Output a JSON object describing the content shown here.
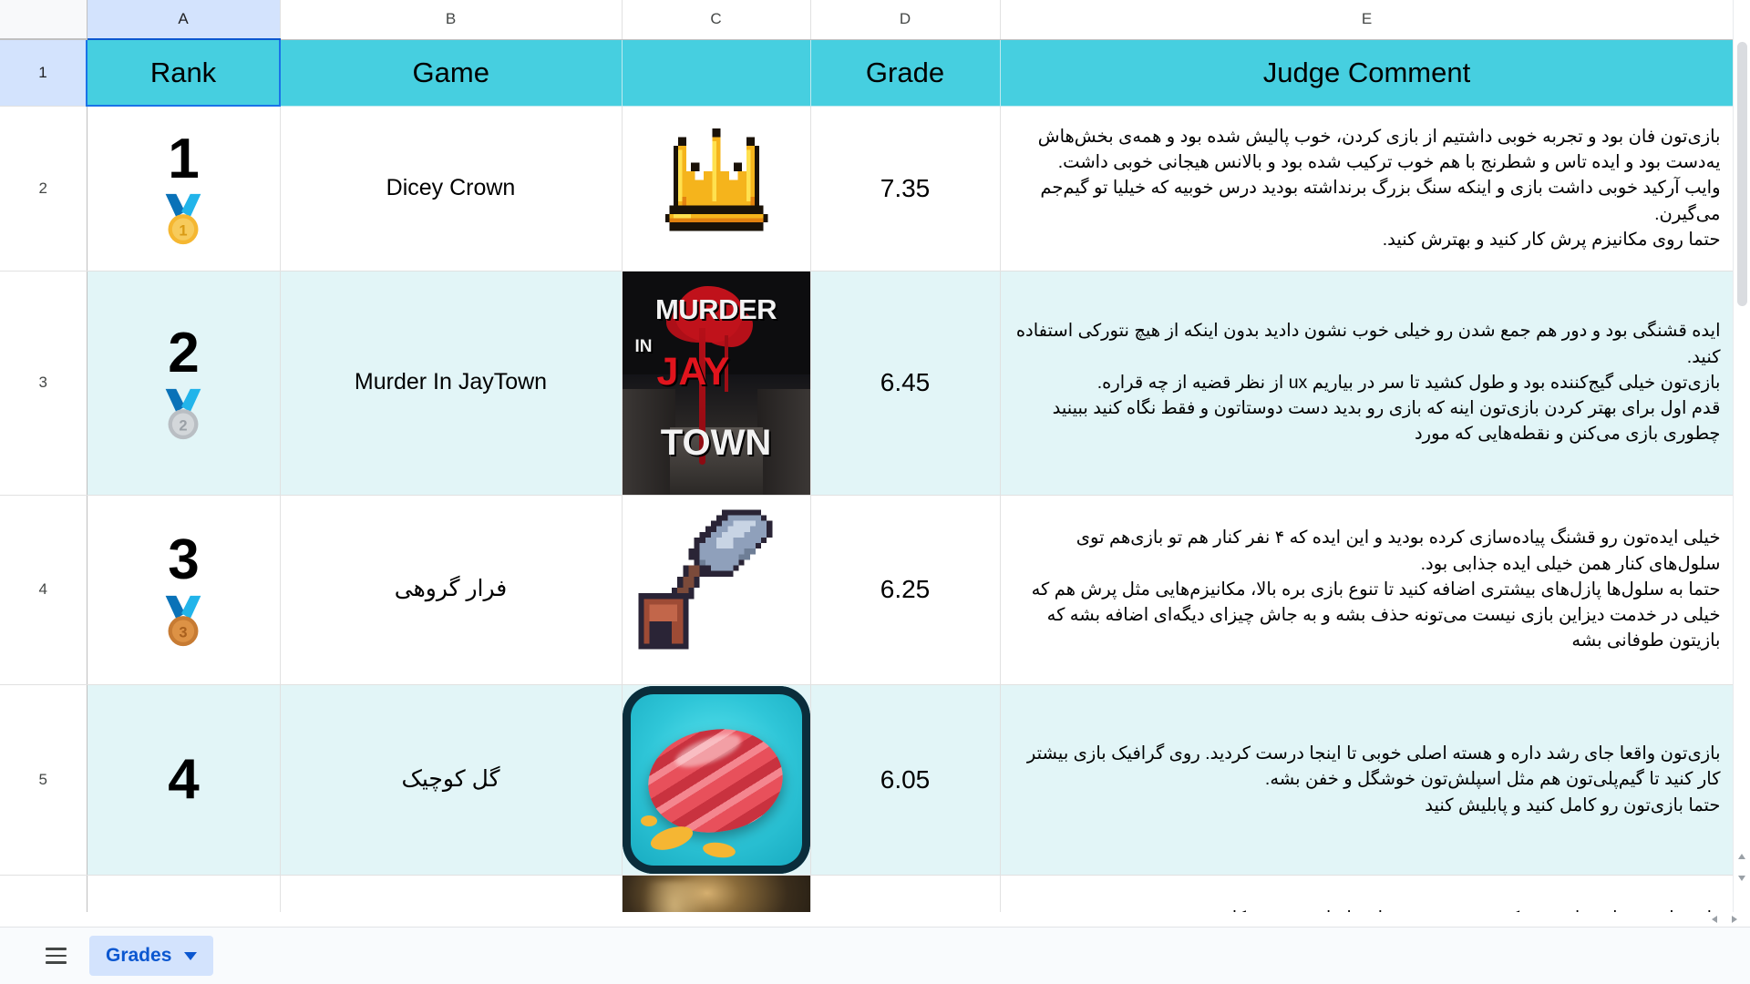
{
  "app": {
    "type": "spreadsheet"
  },
  "colors": {
    "header_band": "#46cfe0",
    "banding_alt": "#e2f5f7",
    "active_header": "#d3e3fd",
    "accent_blue": "#0b57d0",
    "selection_border": "#1a73e8"
  },
  "column_headers": [
    {
      "letter": "A",
      "active": true
    },
    {
      "letter": "B",
      "active": false
    },
    {
      "letter": "C",
      "active": false
    },
    {
      "letter": "D",
      "active": false
    },
    {
      "letter": "E",
      "active": false
    }
  ],
  "row_headers": [
    {
      "num": "1",
      "active": true
    },
    {
      "num": "2",
      "active": false
    },
    {
      "num": "3",
      "active": false
    },
    {
      "num": "4",
      "active": false
    },
    {
      "num": "5",
      "active": false
    },
    {
      "num": "",
      "active": false
    }
  ],
  "table": {
    "headers": {
      "rank": "Rank",
      "game": "Game",
      "grade": "Grade",
      "comment": "Judge Comment"
    },
    "rows": [
      {
        "rank": "1",
        "medal": "gold-medal-icon",
        "medal_number": "1",
        "game": "Dicey Crown",
        "game_rtl": false,
        "thumbnail": "crown-pixel-art",
        "grade": "7.35",
        "comment": "بازی‌تون فان بود و تجربه خوبی داشتیم از بازی کردن، خوب پالیش شده بود و همه‌ی بخش‌هاش یه‌دست بود و ایده تاس و شطرنج با هم خوب ترکیب شده بود و بالانس هیجانی خوبی داشت.\nوایب آرکید خوبی داشت بازی و اینکه سنگ بزرگ برنداشته بودید درس خوبیه که خیلیا تو گیم‌جم می‌گیرن.\nحتما روی مکانیزم پرش کار کنید و بهترش کنید."
      },
      {
        "rank": "2",
        "medal": "silver-medal-icon",
        "medal_number": "2",
        "game": "Murder In JayTown",
        "game_rtl": false,
        "thumbnail": "murder-in-jaytown-poster",
        "grade": "6.45",
        "comment": "ایده قشنگی بود و دور هم جمع شدن رو خیلی خوب نشون دادید بدون اینکه از هیچ نتورکی استفاده کنید.\nبازی‌تون خیلی گیج‌کننده بود و طول کشید تا سر در بیاریم ux از نظر قضیه از چه قراره.\nقدم اول برای بهتر کردن بازی‌تون اینه که بازی رو بدید دست دوستاتون و فقط نگاه کنید ببینید چطوری بازی می‌کنن و نقطه‌هایی که مورد"
      },
      {
        "rank": "3",
        "medal": "bronze-medal-icon",
        "medal_number": "3",
        "game": "فرار گروهی",
        "game_rtl": true,
        "thumbnail": "pickaxe-pixel-art",
        "grade": "6.25",
        "comment": "خیلی ایده‌تون رو قشنگ پیاده‌سازی کرده بودید و این ایده که ۴ نفر کنار هم تو بازی‌هم توی سلول‌های کنار همن خیلی ایده جذابی بود.\nحتما به سلول‌ها پازل‌های بیشتری اضافه کنید تا تنوع بازی بره بالا، مکانیزم‌هایی مثل پرش هم که خیلی در خدمت دیزاین بازی نیست می‌تونه حذف بشه و به جاش چیزای دیگه‌ای اضافه بشه که بازیتون طوفانی بشه"
      },
      {
        "rank": "4",
        "medal": "",
        "medal_number": "",
        "game": "گل کوچیک",
        "game_rtl": true,
        "thumbnail": "ball-game-icon",
        "grade": "6.05",
        "comment": "بازی‌تون واقعا جای رشد داره و هسته اصلی خوبی تا اینجا درست کردید. روی گرافیک بازی بیشتر کار کنید تا گیم‌پلی‌تون هم مثل اسپلش‌تون خوشگل و خفن بشه.\nحتما بازی‌تون رو کامل کنید و پابلیش کنید"
      },
      {
        "rank": "",
        "medal": "",
        "medal_number": "",
        "game": "",
        "game_rtl": false,
        "thumbnail": "dark-game-thumbnail",
        "grade": "",
        "comment": "وایب بازی و پیاده‌سازی نتورک خوب بود و به نظرم اصلی‌ترین مشکلی"
      }
    ]
  },
  "bottom_bar": {
    "menu_icon": "hamburger-icon",
    "sheet_tab_label": "Grades",
    "sheet_tab_caret": "chevron-down-icon"
  }
}
